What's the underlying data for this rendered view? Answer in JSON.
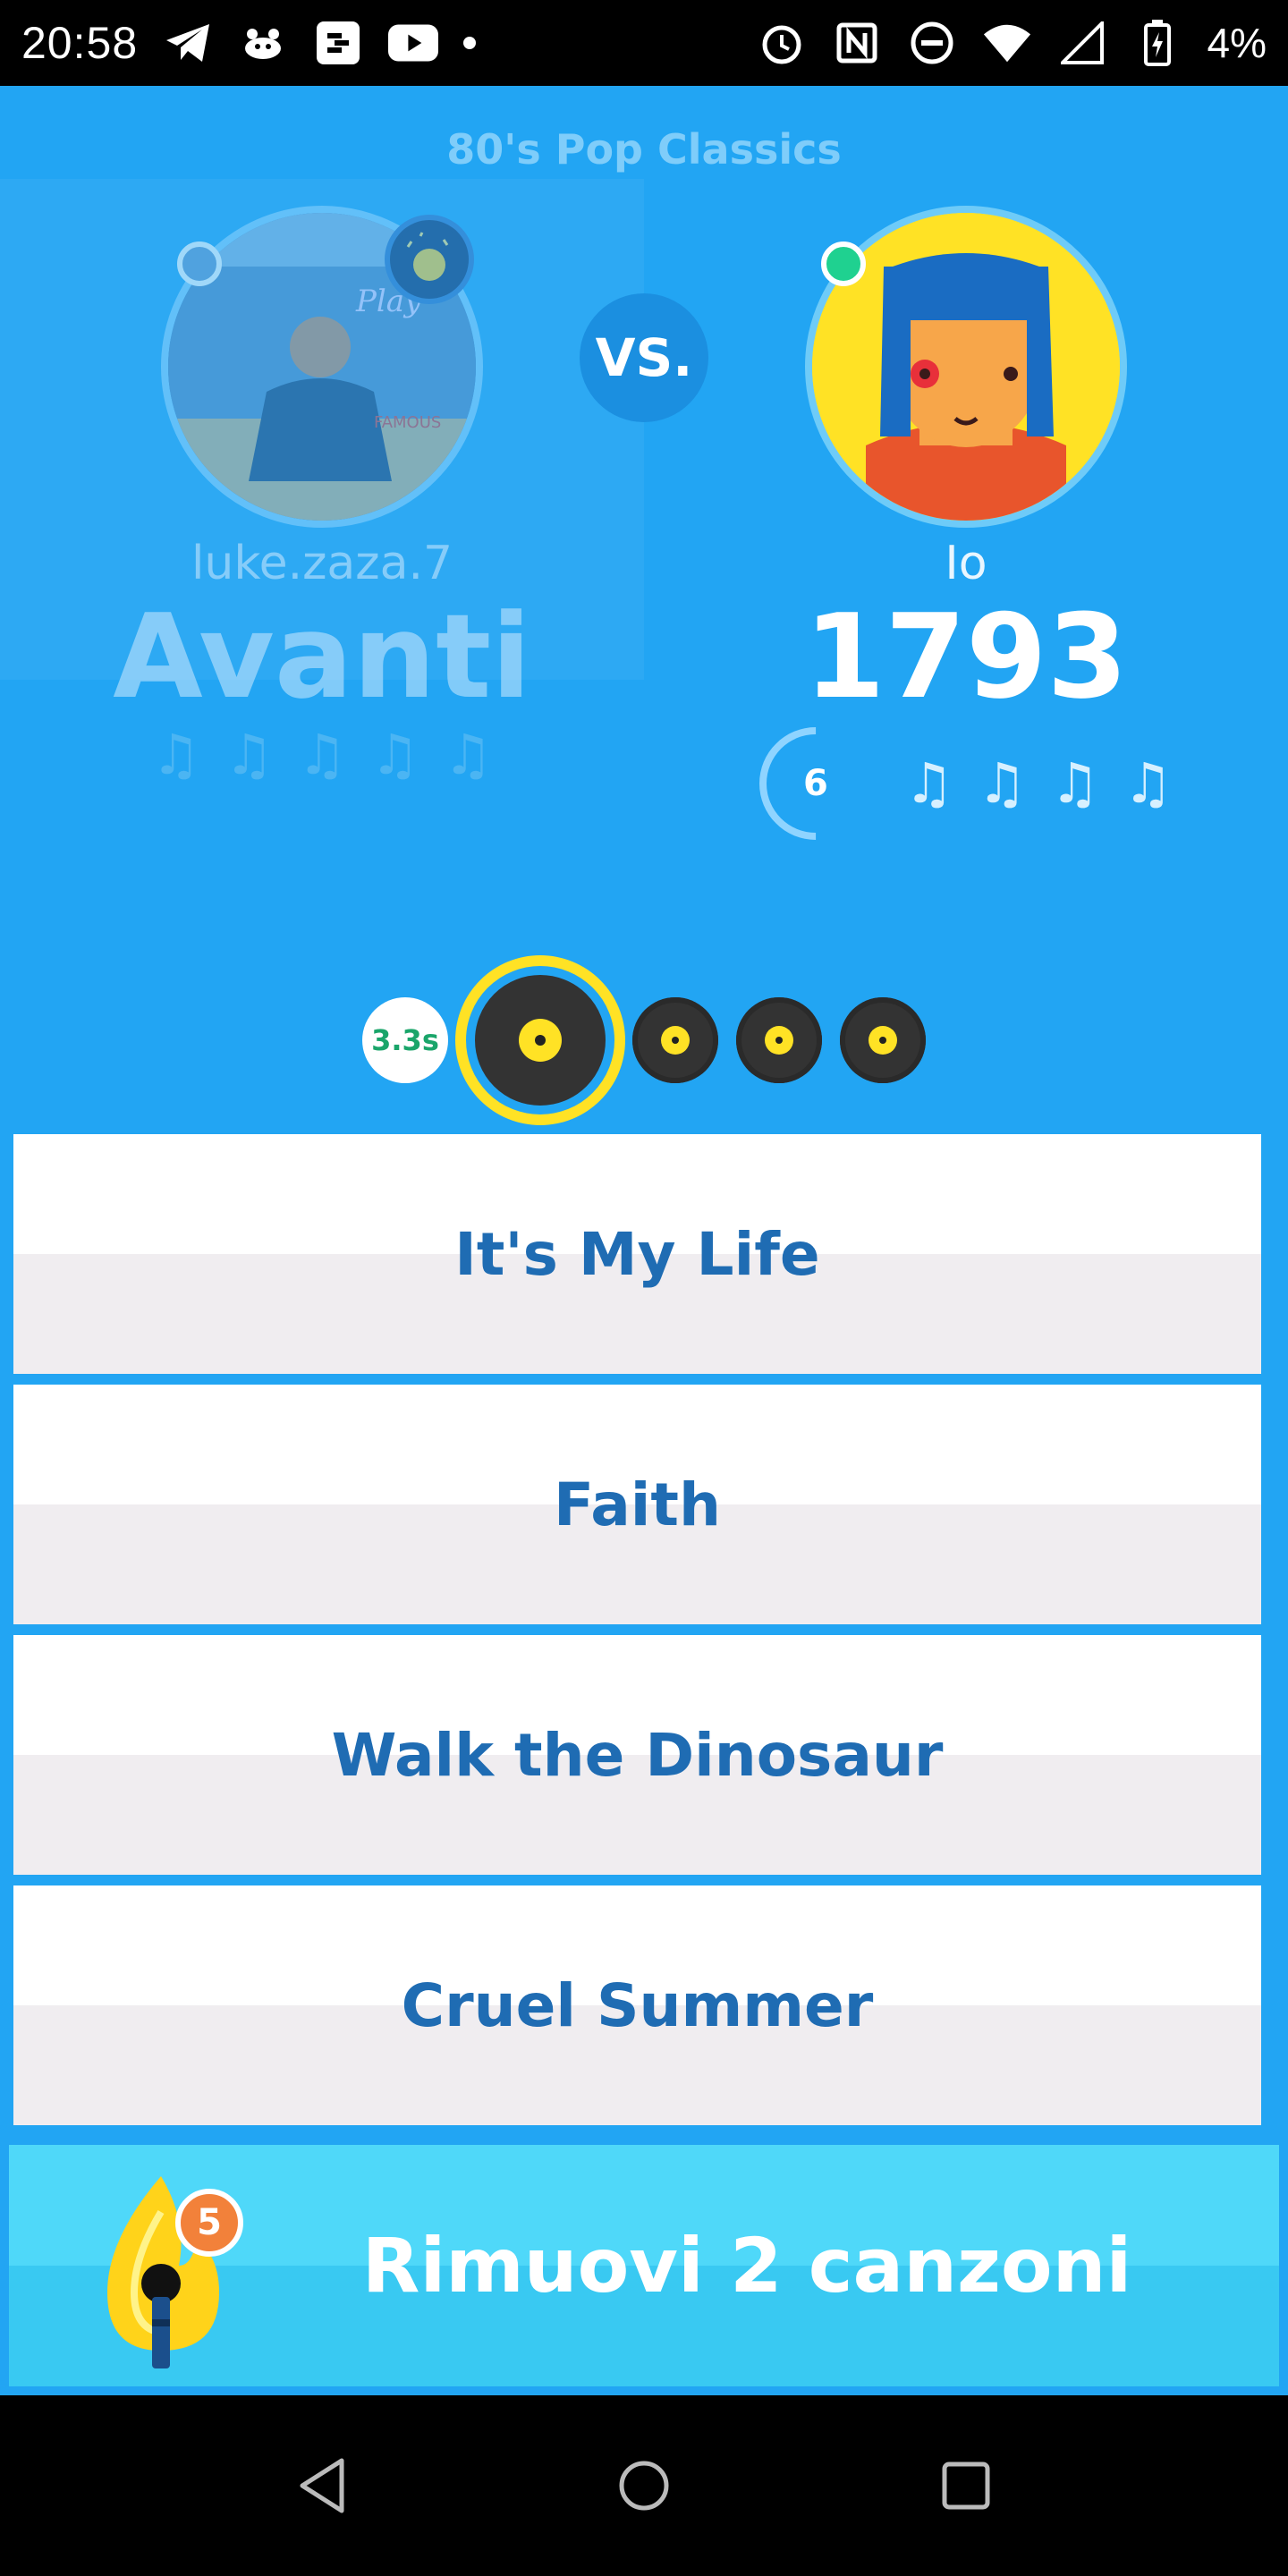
{
  "status_bar": {
    "time": "20:58",
    "battery": "4%",
    "icons": [
      "telegram-icon",
      "cat-icon",
      "swiftkey-icon",
      "youtube-icon",
      "dot-icon",
      "alarm-icon",
      "nfc-icon",
      "dnd-icon",
      "wifi-icon",
      "signal-icon",
      "battery-icon"
    ]
  },
  "game": {
    "playlist_title": "80's Pop Classics",
    "vs_label": "VS.",
    "opponent": {
      "name": "luke.zaza.7",
      "score_label": "Avanti",
      "notes": [
        "♫",
        "♫",
        "♫",
        "♫",
        "♫"
      ]
    },
    "me": {
      "name": "Io",
      "score": "1793",
      "streak": "6",
      "notes": [
        "♫",
        "♫",
        "♫",
        "♫"
      ]
    },
    "timer": "3.3s",
    "rounds": [
      "current",
      "pending",
      "pending",
      "pending"
    ]
  },
  "answers": [
    {
      "label": "It's My Life"
    },
    {
      "label": "Faith"
    },
    {
      "label": "Walk the Dinosaur"
    },
    {
      "label": "Cruel Summer"
    }
  ],
  "powerup": {
    "count": "5",
    "label": "Rimuovi 2 canzoni",
    "icon": "microphone-flame-icon"
  },
  "navbar": {
    "icons": [
      "back-icon",
      "home-icon",
      "recents-icon"
    ]
  },
  "colors": {
    "background": "#22a5f3",
    "answer_text": "#1f6cb3",
    "accent_yellow": "#ffe225",
    "powerup_bg": "#4fd8f9",
    "online_green": "#1fd190"
  }
}
